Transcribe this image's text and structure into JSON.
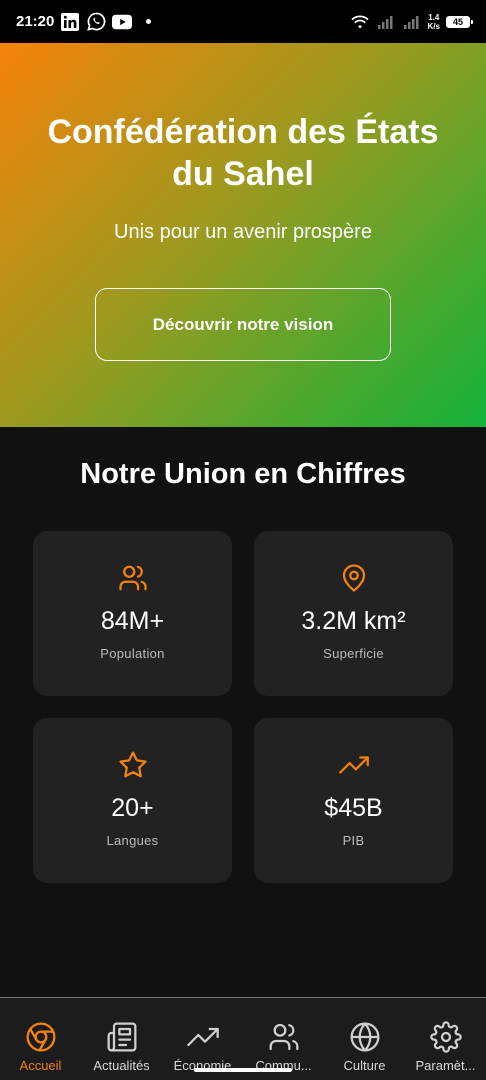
{
  "status_bar": {
    "time": "21:20",
    "net_speed_top": "1.4",
    "net_speed_bottom": "K/s",
    "battery": "45",
    "icons": [
      "linkedin-icon",
      "whatsapp-icon",
      "youtube-icon",
      "wifi-icon",
      "signal-icon",
      "battery-icon"
    ]
  },
  "hero": {
    "title": "Confédération des États du Sahel",
    "subtitle": "Unis pour un avenir prospère",
    "button_label": "Découvrir notre vision",
    "gradient": [
      "#f5820a",
      "#13b23a"
    ]
  },
  "stats": {
    "title": "Notre Union en Chiffres",
    "accent": "#f5820a",
    "items": [
      {
        "icon": "users-icon",
        "value": "84M+",
        "label": "Population"
      },
      {
        "icon": "map-pin-icon",
        "value": "3.2M km²",
        "label": "Superficie"
      },
      {
        "icon": "star-icon",
        "value": "20+",
        "label": "Langues"
      },
      {
        "icon": "trending-up-icon",
        "value": "$45B",
        "label": "PIB"
      }
    ]
  },
  "bottom_nav": {
    "items": [
      {
        "icon": "chrome-icon",
        "label": "Accueil",
        "active": true
      },
      {
        "icon": "newspaper-icon",
        "label": "Actualités"
      },
      {
        "icon": "trending-up-icon",
        "label": "Économie"
      },
      {
        "icon": "users-icon",
        "label": "Commu..."
      },
      {
        "icon": "globe-icon",
        "label": "Culture"
      },
      {
        "icon": "settings-icon",
        "label": "Paramèt..."
      }
    ]
  }
}
